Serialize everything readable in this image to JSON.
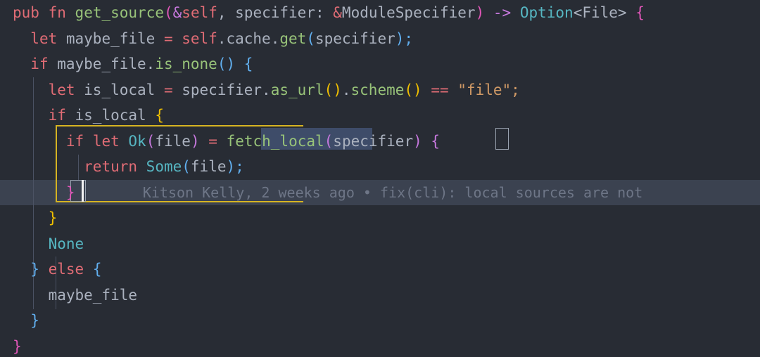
{
  "editor": {
    "language": "rust",
    "font_size_px": 21,
    "line_height_px": 36.5,
    "colors": {
      "background": "#282c34",
      "current_line": "#3b4250",
      "selection": "#3e4c69",
      "indent_guide": "#4b5263",
      "scope_bracket": "#d6b422",
      "bracket_match_border": "#9aa3b0",
      "cursor": "#f2f2f2",
      "keyword": "#e06c75",
      "function": "#98c379",
      "type": "#56b6c2",
      "variable": "#abb2bf",
      "string": "#d19a66",
      "operator": "#e06c75",
      "bracket_magenta": "#e056b8",
      "bracket_blue": "#61afef",
      "bracket_yellow": "#f0c000",
      "bracket_purple": "#c678dd",
      "blame_text": "#6e7687"
    }
  },
  "blame": {
    "author": "Kitson Kelly",
    "when": "2 weeks ago",
    "separator": "•",
    "message": "fix(cli): local sources are not",
    "full_text": "Kitson Kelly, 2 weeks ago • fix(cli): local sources are not"
  },
  "selection": {
    "text": "fetch_local",
    "line_index": 5
  },
  "cursor": {
    "line_index": 7,
    "after_text": "}"
  },
  "lines": [
    {
      "index": 0,
      "indent": 0,
      "tokens": [
        {
          "text": "pub",
          "cls": "t-kw"
        },
        {
          "text": " ",
          "cls": "t-plain"
        },
        {
          "text": "fn",
          "cls": "t-kw"
        },
        {
          "text": " ",
          "cls": "t-plain"
        },
        {
          "text": "get_source",
          "cls": "t-fn"
        },
        {
          "text": "(",
          "cls": "br-magenta"
        },
        {
          "text": "&",
          "cls": "t-arrow"
        },
        {
          "text": "self",
          "cls": "t-kw"
        },
        {
          "text": ", ",
          "cls": "t-plain"
        },
        {
          "text": "specifier",
          "cls": "t-var"
        },
        {
          "text": ": ",
          "cls": "t-plain"
        },
        {
          "text": "&",
          "cls": "t-op"
        },
        {
          "text": "ModuleSpecifier",
          "cls": "t-var"
        },
        {
          "text": ")",
          "cls": "br-magenta"
        },
        {
          "text": " ",
          "cls": "t-plain"
        },
        {
          "text": "->",
          "cls": "t-arrow"
        },
        {
          "text": " ",
          "cls": "t-plain"
        },
        {
          "text": "Option",
          "cls": "t-type"
        },
        {
          "text": "<File>",
          "cls": "t-var"
        },
        {
          "text": " ",
          "cls": "t-plain"
        },
        {
          "text": "{",
          "cls": "br-magenta"
        }
      ]
    },
    {
      "index": 1,
      "indent": 1,
      "tokens": [
        {
          "text": "let",
          "cls": "t-kw"
        },
        {
          "text": " maybe_file ",
          "cls": "t-var"
        },
        {
          "text": "=",
          "cls": "t-op"
        },
        {
          "text": " ",
          "cls": "t-plain"
        },
        {
          "text": "self",
          "cls": "t-kw"
        },
        {
          "text": ".cache.",
          "cls": "t-var"
        },
        {
          "text": "get",
          "cls": "t-fn"
        },
        {
          "text": "(",
          "cls": "br-blue"
        },
        {
          "text": "specifier",
          "cls": "t-var"
        },
        {
          "text": ")",
          "cls": "br-blue"
        },
        {
          "text": ";",
          "cls": "br-blue"
        }
      ]
    },
    {
      "index": 2,
      "indent": 1,
      "tokens": [
        {
          "text": "if",
          "cls": "t-kw"
        },
        {
          "text": " maybe_file.",
          "cls": "t-var"
        },
        {
          "text": "is_none",
          "cls": "t-fn"
        },
        {
          "text": "(",
          "cls": "br-blue"
        },
        {
          "text": ")",
          "cls": "br-blue"
        },
        {
          "text": " ",
          "cls": "t-plain"
        },
        {
          "text": "{",
          "cls": "br-blue"
        }
      ]
    },
    {
      "index": 3,
      "indent": 2,
      "tokens": [
        {
          "text": "let",
          "cls": "t-kw"
        },
        {
          "text": " is_local ",
          "cls": "t-var"
        },
        {
          "text": "=",
          "cls": "t-op"
        },
        {
          "text": " specifier.",
          "cls": "t-var"
        },
        {
          "text": "as_url",
          "cls": "t-fn"
        },
        {
          "text": "(",
          "cls": "br-yellow"
        },
        {
          "text": ")",
          "cls": "br-yellow"
        },
        {
          "text": ".",
          "cls": "t-var"
        },
        {
          "text": "scheme",
          "cls": "t-fn"
        },
        {
          "text": "(",
          "cls": "br-yellow"
        },
        {
          "text": ")",
          "cls": "br-yellow"
        },
        {
          "text": " ",
          "cls": "t-plain"
        },
        {
          "text": "==",
          "cls": "t-op"
        },
        {
          "text": " ",
          "cls": "t-plain"
        },
        {
          "text": "\"file\"",
          "cls": "t-str"
        },
        {
          "text": ";",
          "cls": "t-str"
        }
      ]
    },
    {
      "index": 4,
      "indent": 2,
      "tokens": [
        {
          "text": "if",
          "cls": "t-kw"
        },
        {
          "text": " is_local ",
          "cls": "t-var"
        },
        {
          "text": "{",
          "cls": "br-yellow"
        }
      ]
    },
    {
      "index": 5,
      "indent": 3,
      "tokens": [
        {
          "text": "if",
          "cls": "t-kw"
        },
        {
          "text": " ",
          "cls": "t-plain"
        },
        {
          "text": "let",
          "cls": "t-kw"
        },
        {
          "text": " ",
          "cls": "t-plain"
        },
        {
          "text": "Ok",
          "cls": "t-type"
        },
        {
          "text": "(",
          "cls": "br-purple"
        },
        {
          "text": "file",
          "cls": "t-var"
        },
        {
          "text": ")",
          "cls": "br-purple"
        },
        {
          "text": " ",
          "cls": "t-plain"
        },
        {
          "text": "=",
          "cls": "t-op"
        },
        {
          "text": " ",
          "cls": "t-plain"
        },
        {
          "text": "fetch_local",
          "cls": "t-sel"
        },
        {
          "text": "(",
          "cls": "br-purple"
        },
        {
          "text": "specifier",
          "cls": "t-var"
        },
        {
          "text": ")",
          "cls": "br-purple"
        },
        {
          "text": " ",
          "cls": "t-plain"
        },
        {
          "text": "{",
          "cls": "br-purple"
        }
      ]
    },
    {
      "index": 6,
      "indent": 4,
      "tokens": [
        {
          "text": "return",
          "cls": "t-kw"
        },
        {
          "text": " ",
          "cls": "t-plain"
        },
        {
          "text": "Some",
          "cls": "t-type"
        },
        {
          "text": "(",
          "cls": "br-blue"
        },
        {
          "text": "file",
          "cls": "t-var"
        },
        {
          "text": ")",
          "cls": "br-blue"
        },
        {
          "text": ";",
          "cls": "br-blue"
        }
      ]
    },
    {
      "index": 7,
      "indent": 3,
      "tokens": [
        {
          "text": "}",
          "cls": "br-magenta"
        }
      ]
    },
    {
      "index": 8,
      "indent": 2,
      "tokens": [
        {
          "text": "}",
          "cls": "br-yellow"
        }
      ]
    },
    {
      "index": 9,
      "indent": 2,
      "tokens": [
        {
          "text": "None",
          "cls": "t-type"
        }
      ]
    },
    {
      "index": 10,
      "indent": 1,
      "tokens": [
        {
          "text": "}",
          "cls": "br-blue"
        },
        {
          "text": " ",
          "cls": "t-plain"
        },
        {
          "text": "else",
          "cls": "t-kw"
        },
        {
          "text": " ",
          "cls": "t-plain"
        },
        {
          "text": "{",
          "cls": "br-blue"
        }
      ]
    },
    {
      "index": 11,
      "indent": 2,
      "tokens": [
        {
          "text": "maybe_file",
          "cls": "t-var"
        }
      ]
    },
    {
      "index": 12,
      "indent": 1,
      "tokens": [
        {
          "text": "}",
          "cls": "br-blue"
        }
      ]
    },
    {
      "index": 13,
      "indent": 0,
      "tokens": [
        {
          "text": "}",
          "cls": "br-magenta"
        }
      ]
    }
  ]
}
